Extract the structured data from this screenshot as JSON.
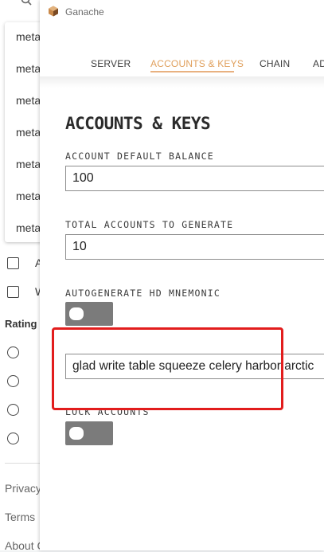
{
  "background": {
    "dropdown_items": [
      "meta",
      "meta",
      "meta",
      "meta",
      "meta",
      "meta",
      "meta"
    ],
    "checkbox_labels": [
      "A",
      "W"
    ],
    "section_title": "Rating",
    "radio_labels": [
      "",
      "",
      "",
      ""
    ],
    "footer_links": [
      "Privacy",
      "Terms",
      "About G"
    ]
  },
  "window": {
    "title": "Ganache",
    "tabs": [
      {
        "label": "SERVER"
      },
      {
        "label": "ACCOUNTS & KEYS"
      },
      {
        "label": "CHAIN"
      },
      {
        "label": "AD"
      }
    ],
    "active_tab": "ACCOUNTS & KEYS",
    "accent_color": "#e0a05d"
  },
  "page": {
    "title": "ACCOUNTS & KEYS",
    "default_balance": {
      "label": "ACCOUNT DEFAULT BALANCE",
      "value": "100"
    },
    "total_accounts": {
      "label": "TOTAL ACCOUNTS TO GENERATE",
      "value": "10"
    },
    "autogenerate": {
      "label": "AUTOGENERATE HD MNEMONIC",
      "enabled": false
    },
    "mnemonic": {
      "value": "glad write table squeeze celery harbor arctic"
    },
    "lock_accounts": {
      "label": "LOCK ACCOUNTS",
      "enabled": false
    }
  },
  "annotation": {
    "color": "#e21d1d"
  }
}
